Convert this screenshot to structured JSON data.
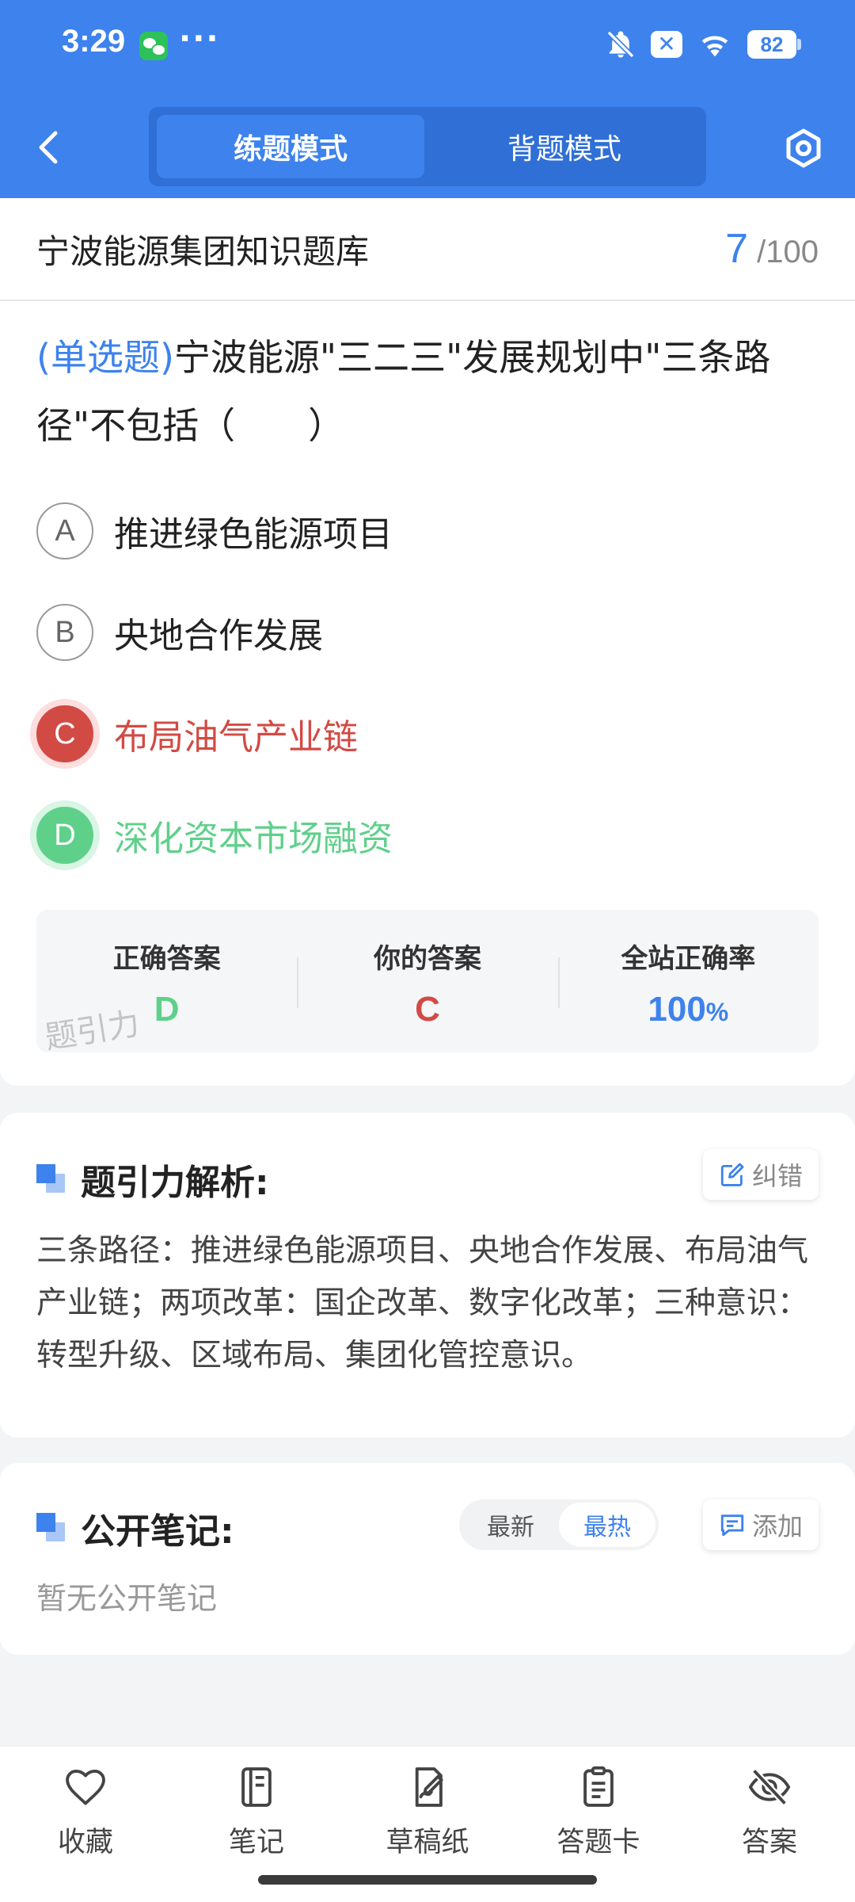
{
  "status_bar": {
    "time": "3:29",
    "more": "···",
    "battery": "82"
  },
  "header": {
    "modes": [
      {
        "label": "练题模式",
        "active": true
      },
      {
        "label": "背题模式",
        "active": false
      }
    ]
  },
  "quiz": {
    "bank_title": "宁波能源集团知识题库",
    "current": "7",
    "separator": "/",
    "total": "100",
    "question_type": "(单选题)",
    "question_text": "宁波能源\"三二三\"发展规划中\"三条路径\"不包括（　　）",
    "options": [
      {
        "letter": "A",
        "text": "推进绿色能源项目",
        "state": "normal"
      },
      {
        "letter": "B",
        "text": "央地合作发展",
        "state": "normal"
      },
      {
        "letter": "C",
        "text": "布局油气产业链",
        "state": "wrong"
      },
      {
        "letter": "D",
        "text": "深化资本市场融资",
        "state": "correct"
      }
    ]
  },
  "answer_summary": {
    "correct_label": "正确答案",
    "correct_value": "D",
    "yours_label": "你的答案",
    "yours_value": "C",
    "rate_label": "全站正确率",
    "rate_value": "100",
    "rate_unit": "%",
    "watermark": "题引力"
  },
  "analysis": {
    "title": "题引力解析:",
    "report_label": "纠错",
    "text": "三条路径：推进绿色能源项目、央地合作发展、布局油气产业链；两项改革：国企改革、数字化改革；三种意识：转型升级、区域布局、集团化管控意识。"
  },
  "notes": {
    "title": "公开笔记:",
    "tabs": [
      {
        "label": "最新",
        "active": false
      },
      {
        "label": "最热",
        "active": true
      }
    ],
    "add_label": "添加",
    "empty_text": "暂无公开笔记"
  },
  "bottom_nav": [
    {
      "label": "收藏",
      "icon": "heart-icon"
    },
    {
      "label": "笔记",
      "icon": "notebook-icon"
    },
    {
      "label": "草稿纸",
      "icon": "draft-paper-icon"
    },
    {
      "label": "答题卡",
      "icon": "answer-card-icon"
    },
    {
      "label": "答案",
      "icon": "eye-off-icon"
    }
  ],
  "colors": {
    "primary": "#3d82ed",
    "wrong": "#d24a44",
    "correct": "#5fd08a"
  }
}
